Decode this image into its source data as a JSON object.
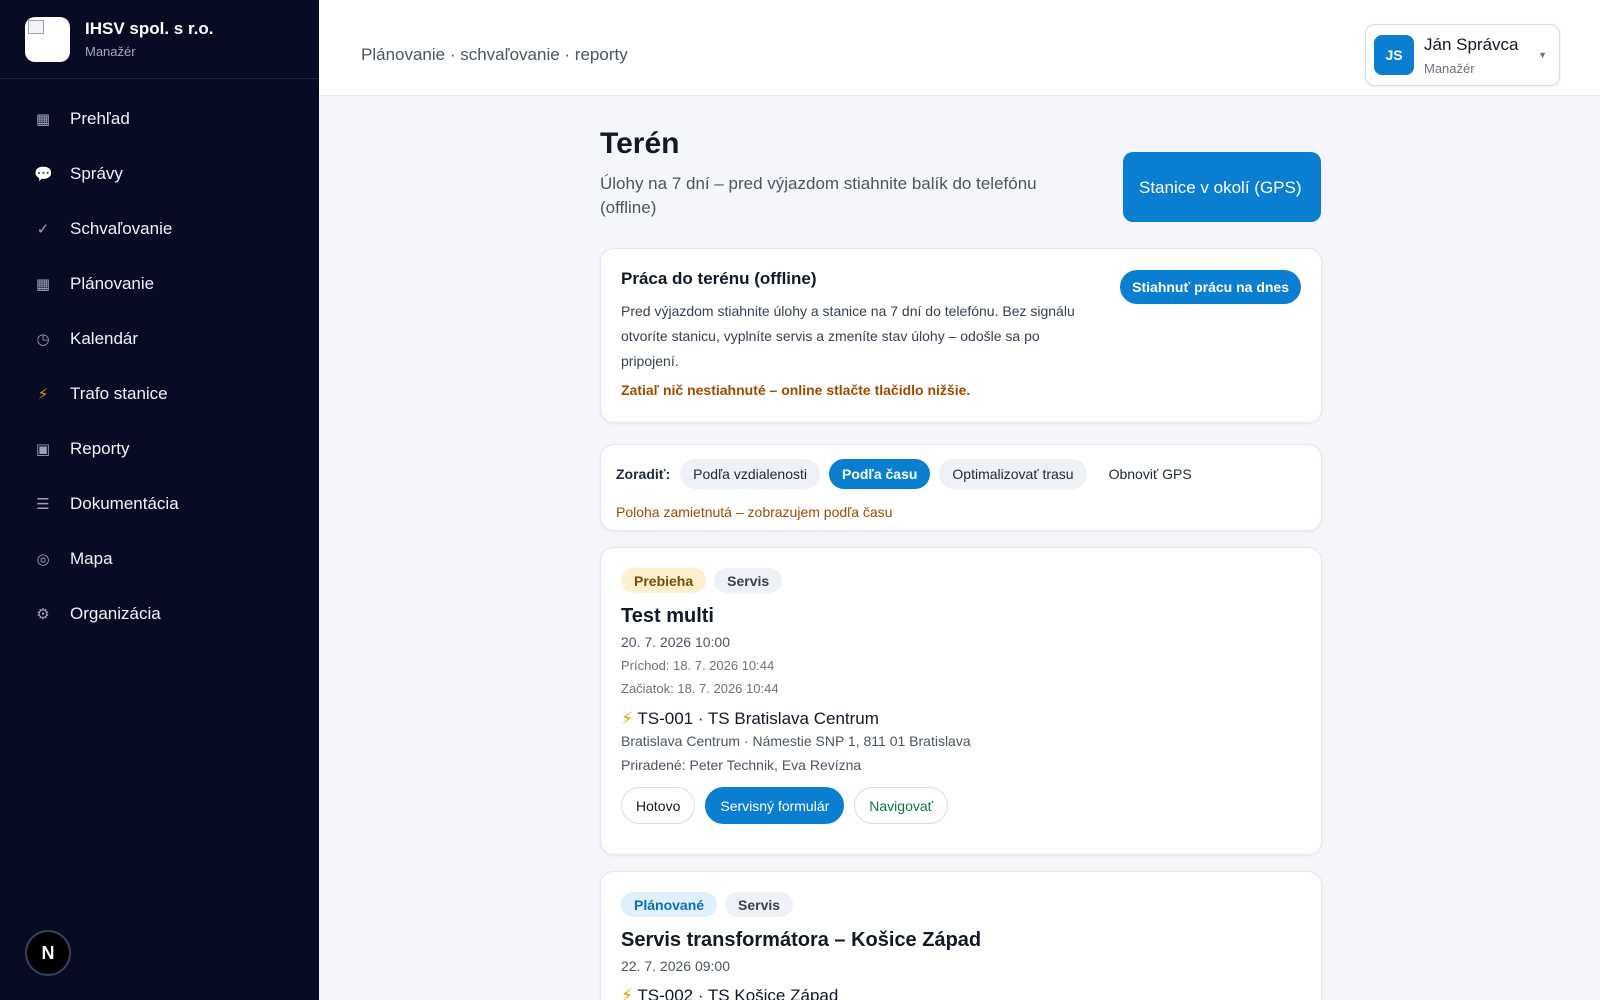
{
  "brand": {
    "name": "IHSV spol. s r.o.",
    "role": "Manažér"
  },
  "sidebar": {
    "items": [
      {
        "icon": "▦",
        "label": "Prehľad"
      },
      {
        "icon": "💬",
        "label": "Správy"
      },
      {
        "icon": "✓",
        "label": "Schvaľovanie"
      },
      {
        "icon": "▦",
        "label": "Plánovanie"
      },
      {
        "icon": "◷",
        "label": "Kalendár"
      },
      {
        "icon": "⚡",
        "label": "Trafo stanice"
      },
      {
        "icon": "▣",
        "label": "Reporty"
      },
      {
        "icon": "☰",
        "label": "Dokumentácia"
      },
      {
        "icon": "◎",
        "label": "Mapa"
      },
      {
        "icon": "⚙",
        "label": "Organizácia"
      }
    ],
    "badge": "N"
  },
  "header": {
    "breadcrumb": "Plánovanie · schvaľovanie · reporty",
    "user": {
      "initials": "JS",
      "name": "Ján Správca",
      "role": "Manažér"
    }
  },
  "page": {
    "title": "Terén",
    "subtitle": "Úlohy na 7 dní – pred výjazdom stiahnite balík do telefónu (offline)",
    "gps_button": "Stanice v okolí (GPS)"
  },
  "offline": {
    "title": "Práca do terénu (offline)",
    "description": "Pred výjazdom stiahnite úlohy a stanice na 7 dní do telefónu. Bez signálu otvoríte stanicu, vyplníte servis a zmeníte stav úlohy – odošle sa po pripojení.",
    "warning": "Zatiaľ nič nestiahnuté – online stlačte tlačidlo nižšie.",
    "download_label": "Stiahnuť prácu na dnes"
  },
  "sort": {
    "label": "Zoradiť:",
    "options": [
      "Podľa vzdialenosti",
      "Podľa času",
      "Optimalizovať trasu",
      "Obnoviť GPS"
    ],
    "active": "Podľa času",
    "note": "Poloha zamietnutá – zobrazujem podľa času"
  },
  "tasks": [
    {
      "status": "Prebieha",
      "type": "Servis",
      "title": "Test multi",
      "when": "20. 7. 2026 10:00",
      "arrival": "Príchod: 18. 7. 2026 10:44",
      "start": "Začiatok: 18. 7. 2026 10:44",
      "station_icon": "⚡",
      "station": "TS-001 · TS Bratislava Centrum",
      "address": "Bratislava Centrum · Námestie SNP 1, 811 01 Bratislava",
      "assigned": "Priradené: Peter Technik, Eva Revízna",
      "actions": {
        "done": "Hotovo",
        "form": "Servisný formulár",
        "navigate": "Navigovať"
      }
    },
    {
      "status": "Plánované",
      "type": "Servis",
      "title": "Servis transformátora – Košice Západ",
      "when": "22. 7. 2026 09:00",
      "station_icon": "⚡",
      "station": "TS-002 · TS Košice Západ"
    }
  ]
}
